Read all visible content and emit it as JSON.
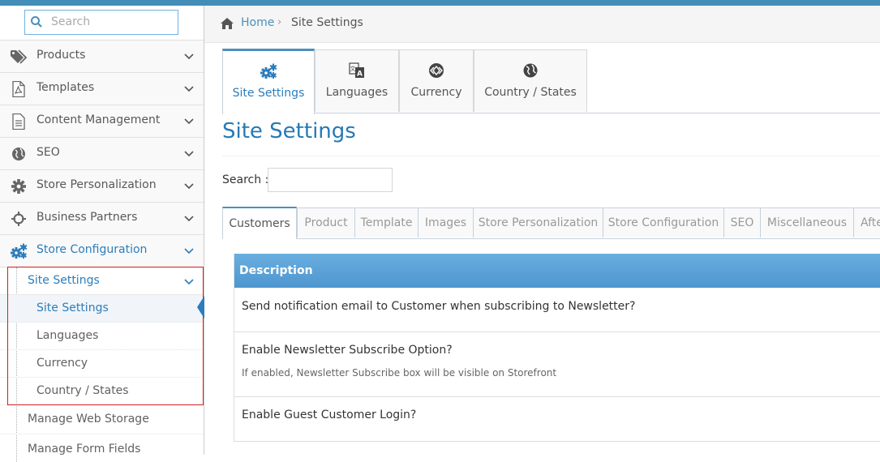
{
  "search": {
    "placeholder": "Search"
  },
  "sidebar": {
    "items": [
      {
        "label": "Products",
        "icon": "tags-icon"
      },
      {
        "label": "Templates",
        "icon": "pdf-file-icon"
      },
      {
        "label": "Content Management",
        "icon": "document-icon"
      },
      {
        "label": "SEO",
        "icon": "globe-icon"
      },
      {
        "label": "Store Personalization",
        "icon": "gear-icon"
      },
      {
        "label": "Business Partners",
        "icon": "crosshair-icon"
      },
      {
        "label": "Store Configuration",
        "icon": "gears-icon"
      }
    ],
    "submenu": {
      "title": "Site Settings",
      "items": [
        "Site Settings",
        "Languages",
        "Currency",
        "Country / States"
      ]
    },
    "extra_items": [
      "Manage Web Storage",
      "Manage Form Fields"
    ]
  },
  "breadcrumb": {
    "home": "Home",
    "separator": "›",
    "current": "Site Settings"
  },
  "top_tabs": [
    "Site Settings",
    "Languages",
    "Currency",
    "Country / States"
  ],
  "page_title": "Site Settings",
  "filter": {
    "label": "Search :",
    "value": ""
  },
  "sub_tabs": [
    "Customers",
    "Product",
    "Template",
    "Images",
    "Store Personalization",
    "Store Configuration",
    "SEO",
    "Miscellaneous",
    "Afte"
  ],
  "table": {
    "header": "Description",
    "rows": [
      {
        "question": "Send notification email to Customer when subscribing to Newsletter?",
        "hint": ""
      },
      {
        "question": "Enable Newsletter Subscribe Option?",
        "hint": "If enabled, Newsletter Subscribe box will be visible on Storefront"
      },
      {
        "question": "Enable Guest Customer Login?",
        "hint": ""
      }
    ]
  },
  "colors": {
    "accent": "#438eb9",
    "link": "#2b7dbc",
    "highlight_border": "#cc2222"
  }
}
